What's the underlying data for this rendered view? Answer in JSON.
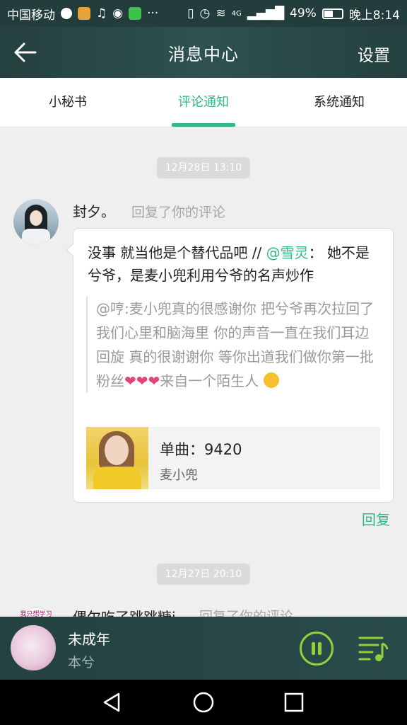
{
  "status_bar": {
    "carrier": "中国移动",
    "battery": "49%",
    "time": "晚上8:14",
    "network": "4G"
  },
  "header": {
    "title": "消息中心",
    "settings_label": "设置",
    "background_color": "#2a4b4b"
  },
  "tabs": [
    {
      "label": "小秘书",
      "active": false
    },
    {
      "label": "评论通知",
      "active": true
    },
    {
      "label": "系统通知",
      "active": false
    }
  ],
  "accent_color": "#2fb786",
  "messages": [
    {
      "timestamp": "12月28日 13:10",
      "sender": "封夕。",
      "action": "回复了你的评论",
      "reply_prefix": "没事 就当他是个替代品吧 // ",
      "mention": "@雪灵",
      "reply_suffix": "： 她不是兮爷，是麦小兜利用兮爷的名声炒作",
      "quoted_text": "@哼:麦小兜真的很感谢你 把兮爷再次拉回了我们心里和脑海里 你的声音一直在我们耳边回旋 真的很谢谢你 等你出道我们做你第一批粉丝",
      "quoted_suffix": "来自一个陌生人",
      "hearts": "❤❤❤",
      "song": {
        "title": "单曲：9420",
        "artist": "麦小兜"
      },
      "reply_button": "回复"
    },
    {
      "timestamp": "12月27日 20:10",
      "sender": "偶尔吃了跳跳糖j",
      "action": "回复了你的评论",
      "avatar_text": "我只想学习"
    }
  ],
  "player": {
    "title": "未成年",
    "artist": "本兮"
  }
}
